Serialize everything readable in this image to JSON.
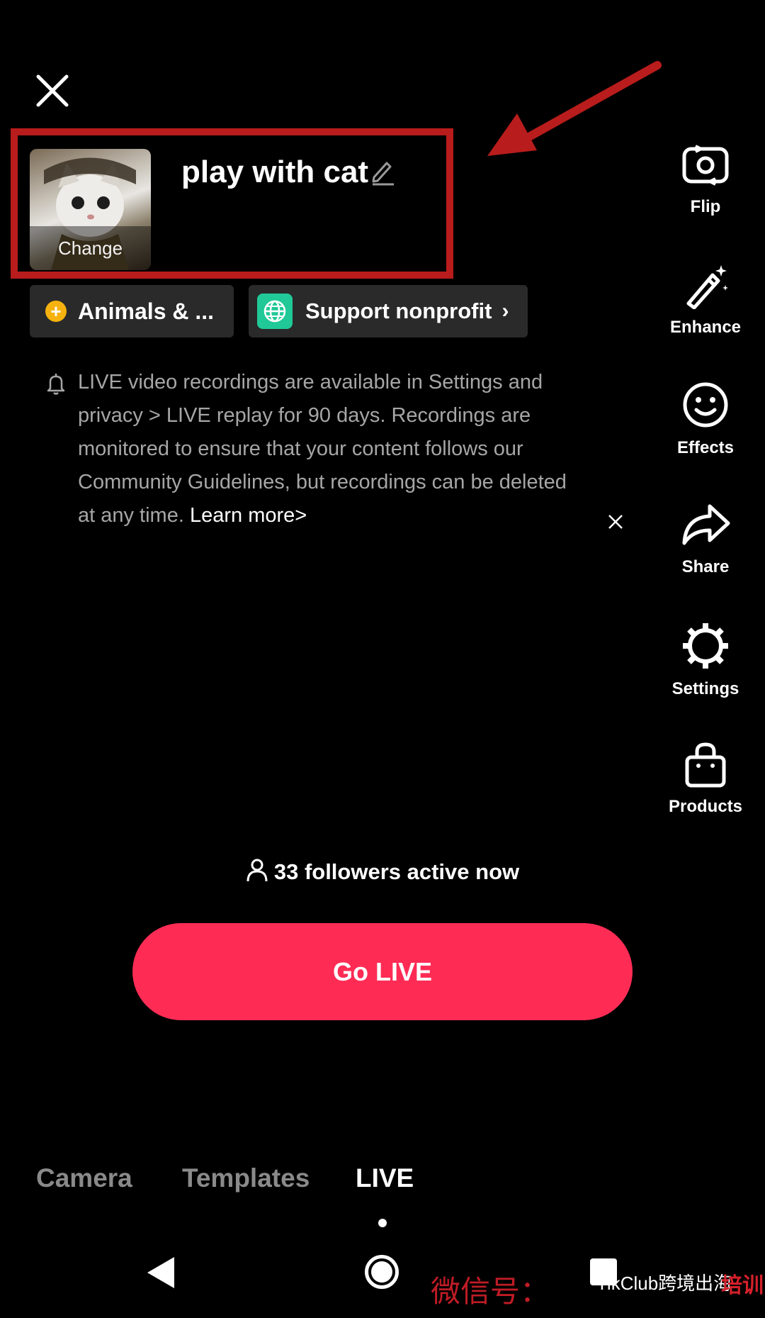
{
  "header": {
    "close_icon": "close-icon"
  },
  "live_setup": {
    "cover_change_label": "Change",
    "title": "play with cat",
    "edit_icon": "pencil-icon"
  },
  "chips": {
    "topic_label": "Animals & ...",
    "topic_icon_glyph": "+",
    "nonprofit_label": "Support nonprofit",
    "nonprofit_chevron": "›"
  },
  "notice": {
    "text": "LIVE video recordings are available in Settings and privacy > LIVE replay for 90 days. Recordings are monitored to ensure that your content follows our Community Guidelines, but recordings can be deleted at any time. ",
    "learn_more": "Learn more>"
  },
  "right_rail": [
    {
      "label": "Flip",
      "icon": "flip-camera-icon"
    },
    {
      "label": "Enhance",
      "icon": "magic-wand-icon"
    },
    {
      "label": "Effects",
      "icon": "smiley-icon"
    },
    {
      "label": "Share",
      "icon": "share-arrow-icon"
    },
    {
      "label": "Settings",
      "icon": "gear-icon"
    },
    {
      "label": "Products",
      "icon": "shopping-bag-icon"
    }
  ],
  "followers_text": "33 followers active now",
  "go_live_label": "Go LIVE",
  "mode_tabs": [
    {
      "label": "Camera",
      "active": false
    },
    {
      "label": "Templates",
      "active": false
    },
    {
      "label": "LIVE",
      "active": true
    }
  ],
  "watermark": {
    "cn_label": "微信号：",
    "brand": "TikClub跨境出海",
    "brand_tail": "培训"
  },
  "colors": {
    "accent": "#fe2c55",
    "annotation": "#b91c1c",
    "topic_dot": "#f6b30f",
    "nonprofit_icon": "#20c997"
  }
}
